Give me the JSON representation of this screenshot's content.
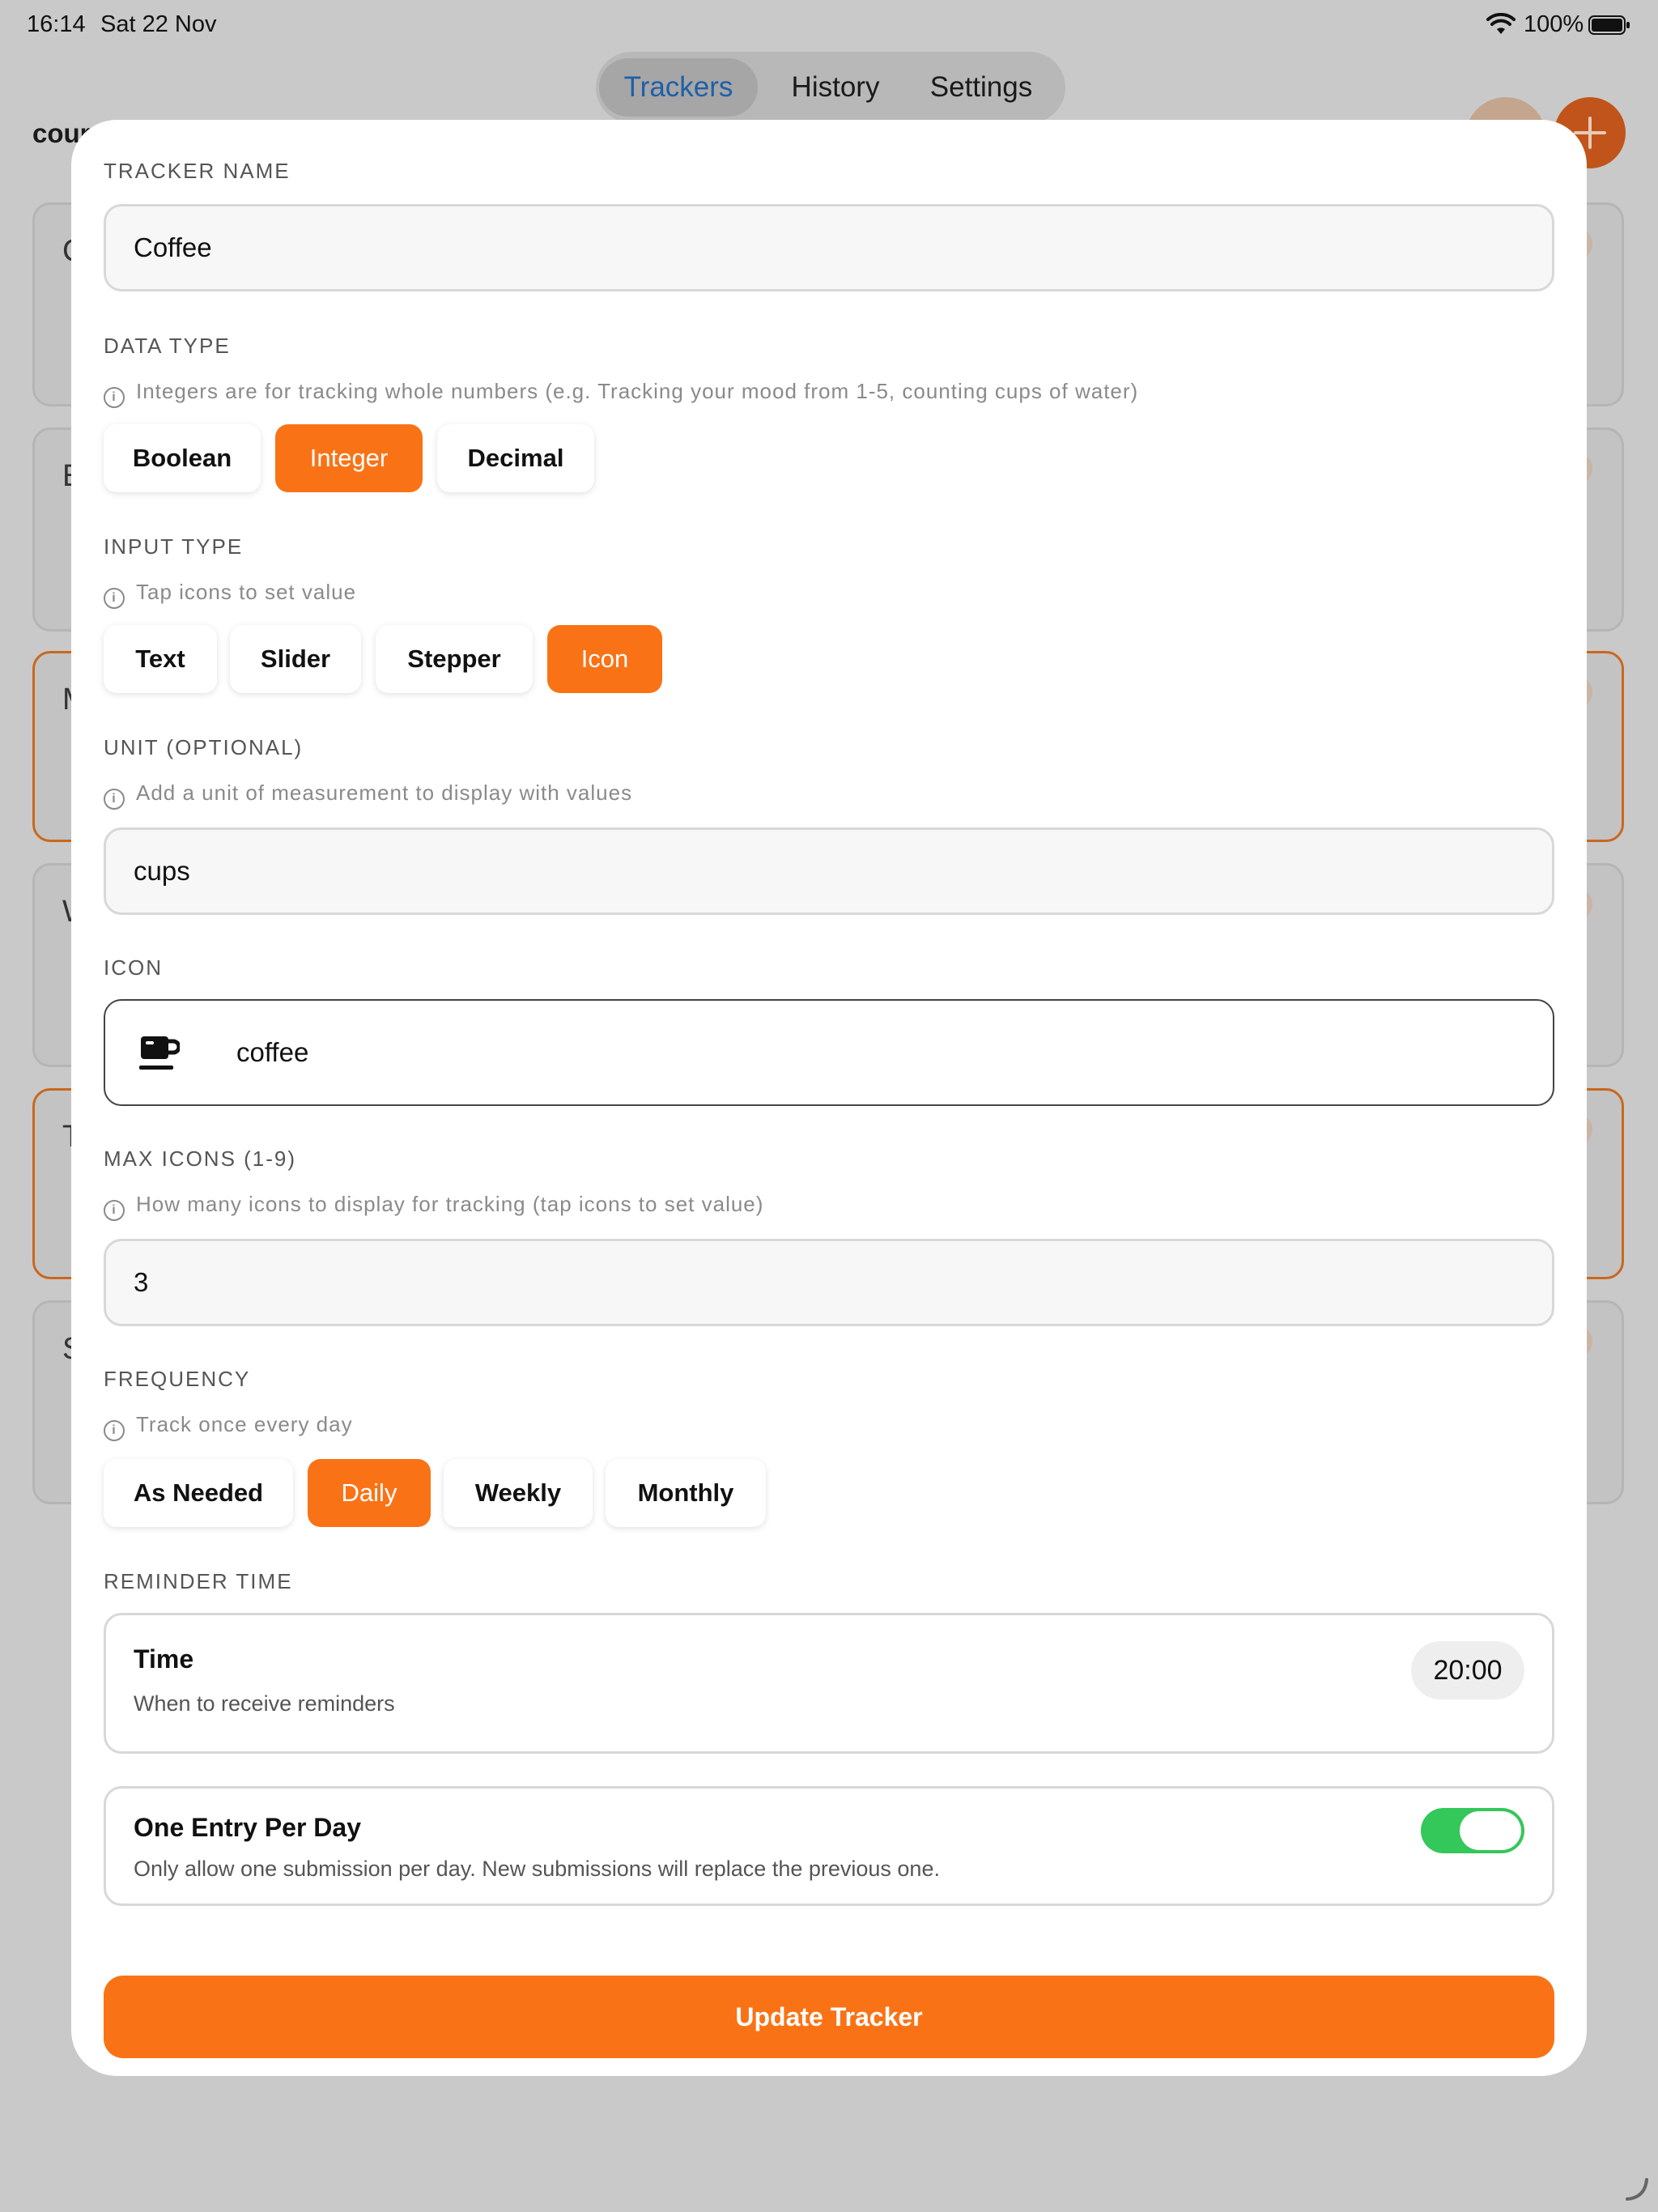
{
  "status_bar": {
    "time": "16:14",
    "date": "Sat 22 Nov",
    "battery": "100%"
  },
  "background": {
    "tabs": [
      {
        "label": "Trackers",
        "active": true
      },
      {
        "label": "History",
        "active": false
      },
      {
        "label": "Settings",
        "active": false
      }
    ],
    "title_fragment": "cour",
    "card_initials": [
      "C",
      "E",
      "M",
      "W",
      "T",
      "S"
    ],
    "accent": "#c8681f"
  },
  "form": {
    "tracker_name": {
      "label": "TRACKER NAME",
      "value": "Coffee"
    },
    "data_type": {
      "label": "DATA TYPE",
      "hint": "Integers are for tracking whole numbers (e.g. Tracking your mood from 1-5, counting cups of water)",
      "options": [
        "Boolean",
        "Integer",
        "Decimal"
      ],
      "selected": "Integer"
    },
    "input_type": {
      "label": "INPUT TYPE",
      "hint": "Tap icons to set value",
      "options": [
        "Text",
        "Slider",
        "Stepper",
        "Icon"
      ],
      "selected": "Icon"
    },
    "unit": {
      "label": "UNIT (OPTIONAL)",
      "hint": "Add a unit of measurement to display with values",
      "value": "cups"
    },
    "icon": {
      "label": "ICON",
      "value": "coffee",
      "glyph": "coffee-icon"
    },
    "max_icons": {
      "label": "MAX ICONS (1-9)",
      "hint": "How many icons to display for tracking (tap icons to set value)",
      "value": "3"
    },
    "frequency": {
      "label": "FREQUENCY",
      "hint": "Track once every day",
      "options": [
        "As Needed",
        "Daily",
        "Weekly",
        "Monthly"
      ],
      "selected": "Daily"
    },
    "reminder": {
      "label": "REMINDER TIME",
      "title": "Time",
      "subtitle": "When to receive reminders",
      "value": "20:00"
    },
    "one_entry": {
      "title": "One Entry Per Day",
      "subtitle": "Only allow one submission per day. New submissions will replace the previous one.",
      "enabled": true
    },
    "submit_label": "Update Tracker"
  },
  "colors": {
    "accent": "#f97316",
    "toggle_on": "#34c759",
    "tab_active_text": "#1f5fa8"
  }
}
